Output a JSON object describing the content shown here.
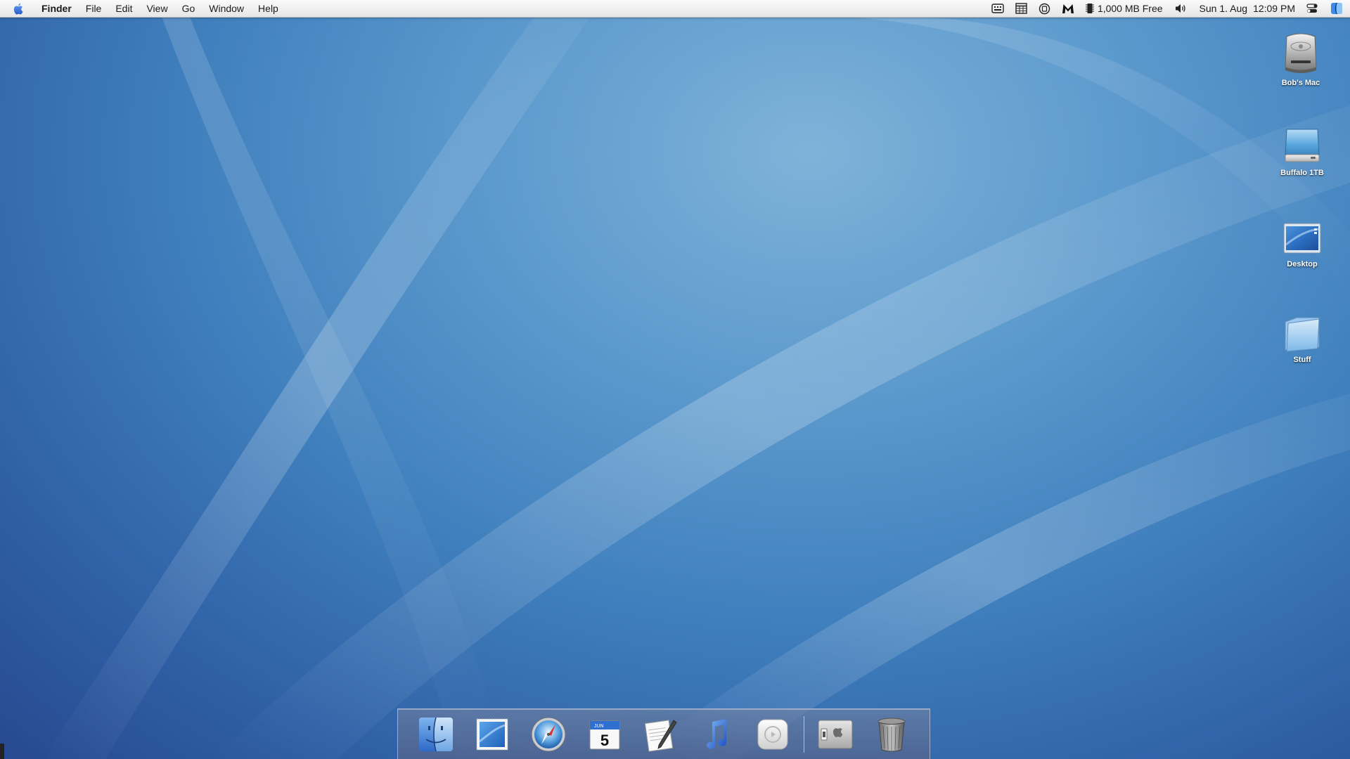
{
  "menubar": {
    "app_name": "Finder",
    "menus": [
      "File",
      "Edit",
      "View",
      "Go",
      "Window",
      "Help"
    ],
    "memory_status": "1,000 MB Free",
    "date": "Sun 1. Aug",
    "time": "12:09 PM"
  },
  "desktop_icons": [
    {
      "label": "Bob's Mac",
      "icon": "hard-drive-icon"
    },
    {
      "label": "Buffalo 1TB",
      "icon": "external-drive-icon"
    },
    {
      "label": "Desktop",
      "icon": "desktop-folder-icon"
    },
    {
      "label": "Stuff",
      "icon": "folder-icon"
    }
  ],
  "dock": {
    "items": [
      {
        "name": "Finder",
        "icon": "finder-icon"
      },
      {
        "name": "Preview",
        "icon": "preview-icon"
      },
      {
        "name": "Safari",
        "icon": "safari-compass-icon"
      },
      {
        "name": "iCal",
        "icon": "calendar-icon",
        "day": "5"
      },
      {
        "name": "TextEdit",
        "icon": "textedit-icon"
      },
      {
        "name": "iTunes",
        "icon": "music-note-icon"
      },
      {
        "name": "Front Row",
        "icon": "front-row-icon"
      },
      {
        "name": "System Preferences",
        "icon": "switch-icon"
      },
      {
        "name": "Trash",
        "icon": "trash-icon"
      }
    ]
  },
  "colors": {
    "wallpaper_light": "#7fb3d9",
    "wallpaper_dark": "#27498f",
    "menubar": "#f0f0f0"
  }
}
